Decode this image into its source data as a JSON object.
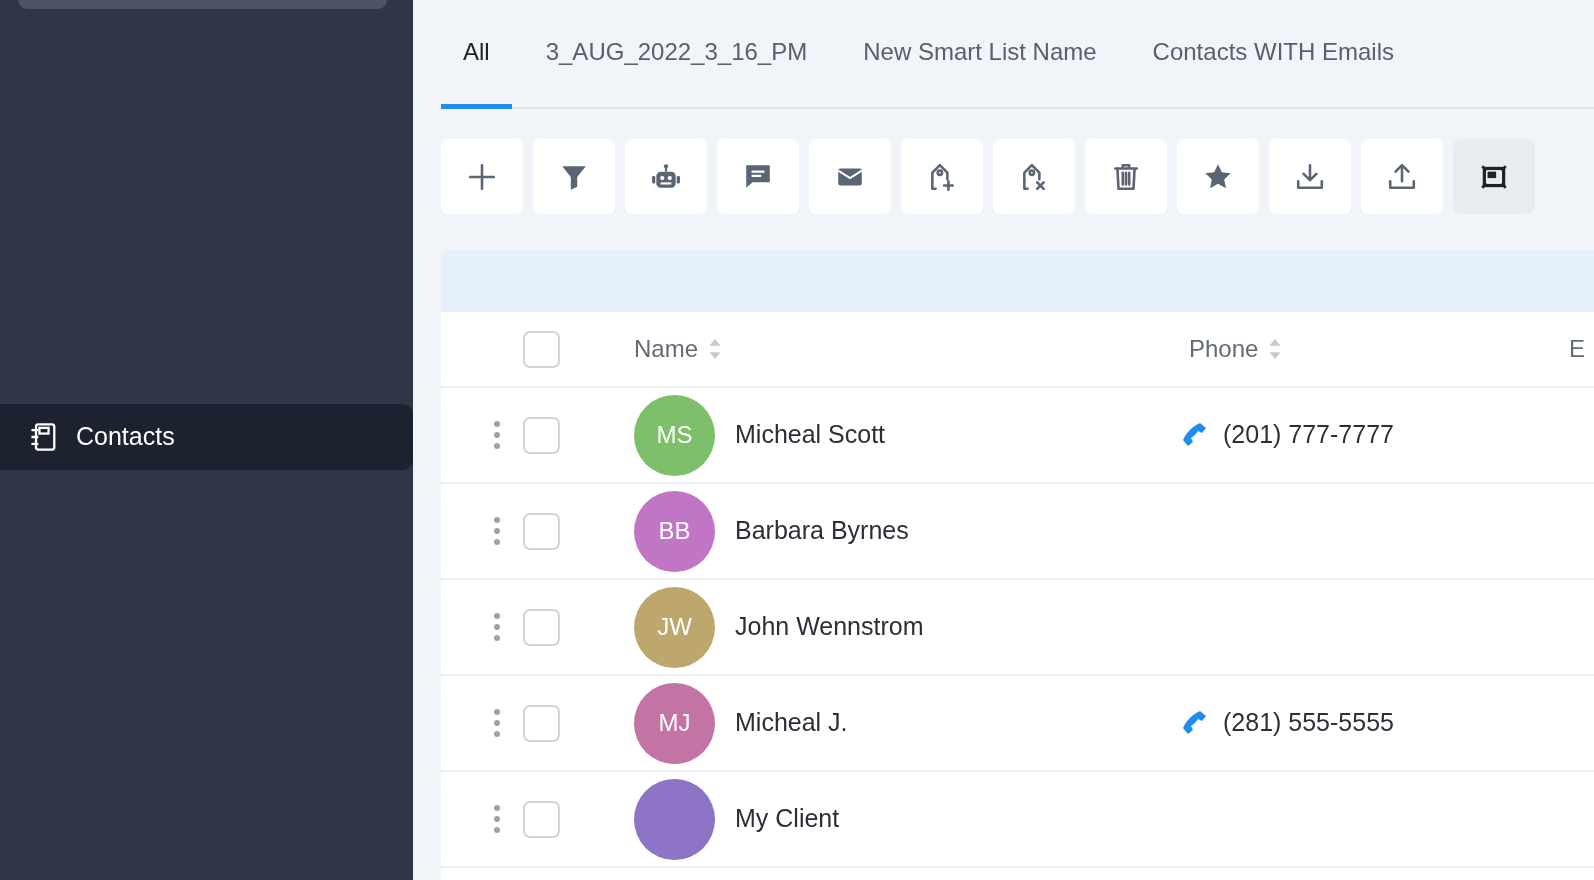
{
  "sidebar": {
    "items": [
      {
        "label": "Contacts",
        "selected": true
      }
    ]
  },
  "tabs": [
    {
      "label": "All",
      "selected": true
    },
    {
      "label": "3_AUG_2022_3_16_PM",
      "selected": false
    },
    {
      "label": "New Smart List Name",
      "selected": false
    },
    {
      "label": "Contacts WITH Emails",
      "selected": false
    }
  ],
  "toolbar": [
    {
      "kind": "plus",
      "active": false
    },
    {
      "kind": "filter",
      "active": false
    },
    {
      "kind": "robot",
      "active": false
    },
    {
      "kind": "message",
      "active": false
    },
    {
      "kind": "mail",
      "active": false
    },
    {
      "kind": "tag-add",
      "active": false
    },
    {
      "kind": "tag-remove",
      "active": false
    },
    {
      "kind": "trash",
      "active": false
    },
    {
      "kind": "star",
      "active": false
    },
    {
      "kind": "download",
      "active": false
    },
    {
      "kind": "upload",
      "active": false
    },
    {
      "kind": "frame",
      "active": true
    }
  ],
  "table": {
    "select_all_checked": false,
    "columns": [
      "Name",
      "Phone",
      "E"
    ],
    "rows": [
      {
        "initials": "MS",
        "color": "#7dbf6a",
        "name": "Micheal Scott",
        "phone": "(201) 777-7777",
        "checked": false
      },
      {
        "initials": "BB",
        "color": "#c076c4",
        "name": "Barbara Byrnes",
        "checked": false
      },
      {
        "initials": "JW",
        "color": "#bea76c",
        "name": "John Wennstrom",
        "checked": false
      },
      {
        "initials": "MJ",
        "color": "#c373a4",
        "name": "Micheal J.",
        "phone": "(281) 555-5555",
        "checked": false
      },
      {
        "color": "#8d74c6",
        "name": "My Client",
        "checked": false
      }
    ]
  }
}
